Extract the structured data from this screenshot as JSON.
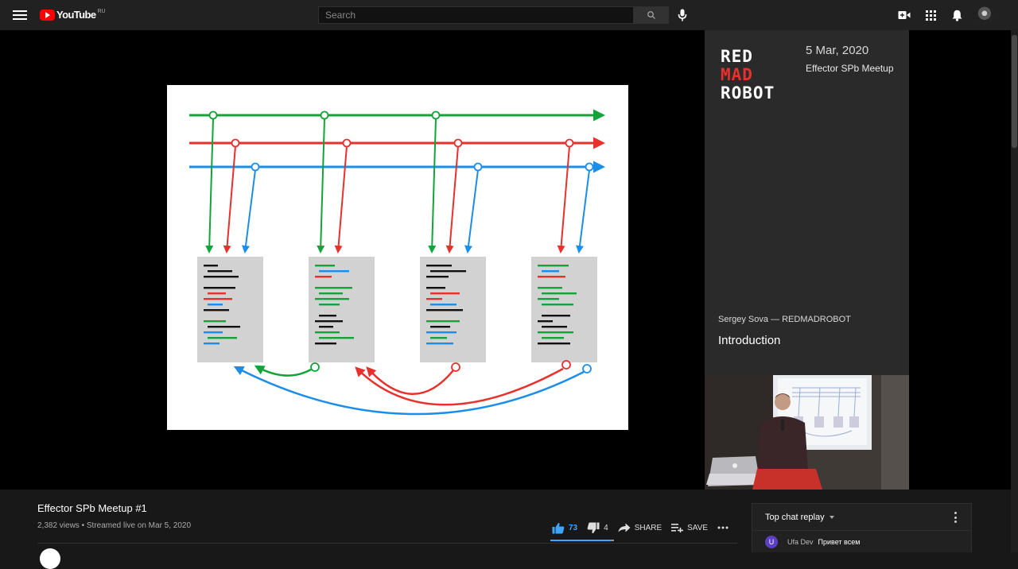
{
  "header": {
    "logo_text": "YouTube",
    "logo_region": "RU",
    "search_placeholder": "Search"
  },
  "slide": {
    "colors": {
      "green": "#13a33a",
      "red": "#e8312d",
      "blue": "#1c8de8",
      "black": "#111111"
    }
  },
  "side_panel": {
    "brand_lines": [
      "RED",
      "MAD",
      "ROBOT"
    ],
    "date": "5 Mar, 2020",
    "event": "Effector SPb Meetup",
    "speaker": "Sergey Sova — REDMADROBOT",
    "topic": "Introduction"
  },
  "video": {
    "title": "Effector SPb Meetup #1",
    "meta": "2,382 views • Streamed live on Mar 5, 2020",
    "likes": "73",
    "dislikes": "4",
    "share_label": "SHARE",
    "save_label": "SAVE",
    "like_ratio": 0.95
  },
  "chat": {
    "header": "Top chat replay",
    "messages": [
      {
        "initial": "U",
        "author": "Ufa Dev",
        "text": "Привет всем"
      }
    ]
  },
  "colors": {
    "accent_blue": "#3ea6ff",
    "youtube_red": "#ff0000",
    "background": "#181818",
    "topbar": "#212121"
  }
}
